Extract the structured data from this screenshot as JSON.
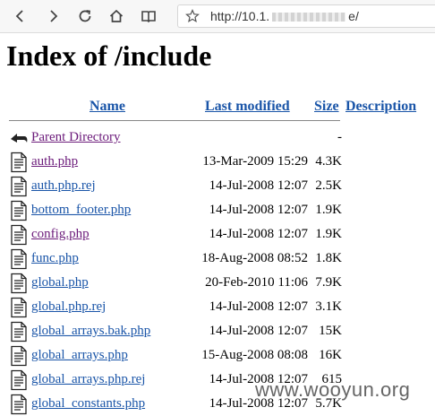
{
  "browser": {
    "url_prefix": "http://10.1.",
    "url_suffix": "e/"
  },
  "page": {
    "title": "Index of /include",
    "columns": {
      "name": "Name",
      "last_modified": "Last modified",
      "size": "Size",
      "description": "Description"
    },
    "parent": {
      "name": "Parent Directory",
      "size": "-"
    },
    "files": [
      {
        "name": "auth.php",
        "modified": "13-Mar-2009 15:29",
        "size": "4.3K",
        "visited": true
      },
      {
        "name": "auth.php.rej",
        "modified": "14-Jul-2008 12:07",
        "size": "2.5K",
        "visited": false
      },
      {
        "name": "bottom_footer.php",
        "modified": "14-Jul-2008 12:07",
        "size": "1.9K",
        "visited": false
      },
      {
        "name": "config.php",
        "modified": "14-Jul-2008 12:07",
        "size": "1.9K",
        "visited": true
      },
      {
        "name": "func.php",
        "modified": "18-Aug-2008 08:52",
        "size": "1.8K",
        "visited": false
      },
      {
        "name": "global.php",
        "modified": "20-Feb-2010 11:06",
        "size": "7.9K",
        "visited": false
      },
      {
        "name": "global.php.rej",
        "modified": "14-Jul-2008 12:07",
        "size": "3.1K",
        "visited": false
      },
      {
        "name": "global_arrays.bak.php",
        "modified": "14-Jul-2008 12:07",
        "size": "15K",
        "visited": false
      },
      {
        "name": "global_arrays.php",
        "modified": "15-Aug-2008 08:08",
        "size": "16K",
        "visited": false
      },
      {
        "name": "global_arrays.php.rej",
        "modified": "14-Jul-2008 12:07",
        "size": "615",
        "visited": false
      },
      {
        "name": "global_constants.php",
        "modified": "14-Jul-2008 12:07",
        "size": "5.7K",
        "visited": false
      }
    ]
  },
  "watermark": "www.wooyun.org",
  "colors": {
    "link": "#1a55a8",
    "visited": "#6b1a7a"
  }
}
